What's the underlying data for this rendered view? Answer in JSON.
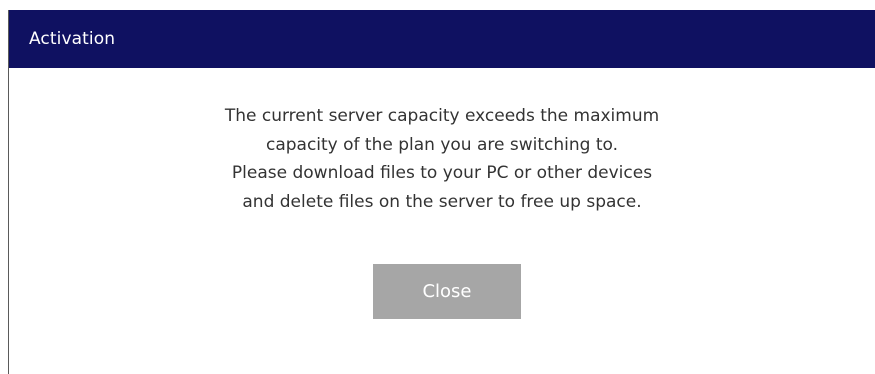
{
  "dialog": {
    "title": "Activation",
    "message_lines": [
      "The current server capacity exceeds the maximum",
      "capacity of the plan you are switching to.",
      "Please download files to your PC or other devices",
      "and delete files on the server to free up space."
    ],
    "close_label": "Close"
  },
  "colors": {
    "titlebar_bg": "#0f1161",
    "button_bg": "#a6a6a6",
    "text": "#333333"
  }
}
